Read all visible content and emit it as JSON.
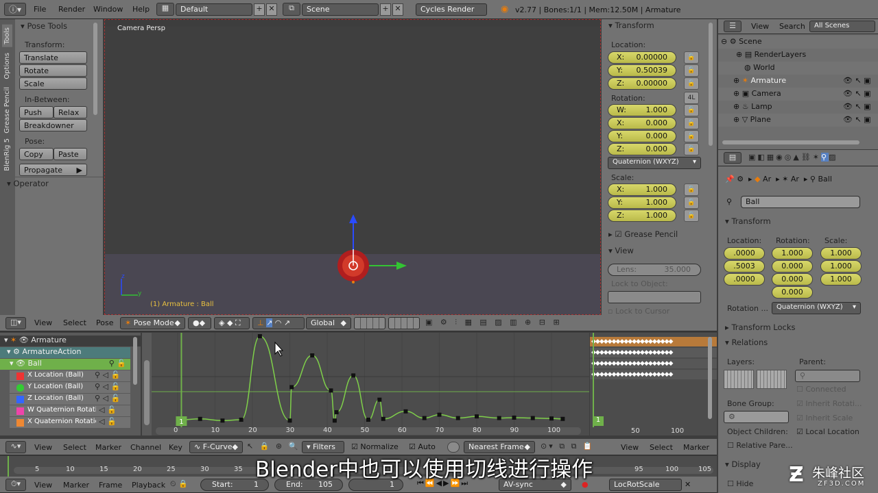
{
  "topbar": {
    "menus": [
      "File",
      "Render",
      "Window",
      "Help"
    ],
    "layout": "Default",
    "scene": "Scene",
    "engine": "Cycles Render",
    "stats": "v2.77 | Bones:1/1 | Mem:12.50M | Armature"
  },
  "tabs_left": [
    "Tools",
    "Options",
    "Grease Pencil",
    "BlenRig 5"
  ],
  "toolshelf": {
    "title": "Pose Tools",
    "transform_label": "Transform:",
    "translate": "Translate",
    "rotate": "Rotate",
    "scale": "Scale",
    "inbetween_label": "In-Between:",
    "push": "Push",
    "relax": "Relax",
    "breakdowner": "Breakdowner",
    "pose_label": "Pose:",
    "copy": "Copy",
    "paste": "Paste",
    "propagate": "Propagate",
    "operator": "Operator"
  },
  "viewport": {
    "title": "Camera Persp",
    "info": "(1) Armature : Ball",
    "axis_z": "z",
    "axis_y": "y"
  },
  "npanel": {
    "transform": "Transform",
    "location_label": "Location:",
    "loc": [
      {
        "k": "X:",
        "v": "0.00000"
      },
      {
        "k": "Y:",
        "v": "0.50039"
      },
      {
        "k": "Z:",
        "v": "0.00000"
      }
    ],
    "rotation_label": "Rotation:",
    "rot_badge": "4L",
    "rot": [
      {
        "k": "W:",
        "v": "1.000"
      },
      {
        "k": "X:",
        "v": "0.000"
      },
      {
        "k": "Y:",
        "v": "0.000"
      },
      {
        "k": "Z:",
        "v": "0.000"
      }
    ],
    "rot_mode": "Quaternion (WXYZ)",
    "scale_label": "Scale:",
    "scl": [
      {
        "k": "X:",
        "v": "1.000"
      },
      {
        "k": "Y:",
        "v": "1.000"
      },
      {
        "k": "Z:",
        "v": "1.000"
      }
    ],
    "grease_pencil": "Grease Pencil",
    "view": "View",
    "lens_label": "Lens:",
    "lens_value": "35.000",
    "lock_object": "Lock to Object:",
    "lock_cursor": "Lock to Cursor"
  },
  "view3d_header": {
    "view": "View",
    "select": "Select",
    "pose": "Pose",
    "mode": "Pose Mode",
    "orientation": "Global"
  },
  "outliner": {
    "view": "View",
    "search": "Search",
    "filter": "All Scenes",
    "items": [
      "Scene",
      "RenderLayers",
      "World",
      "Armature",
      "Camera",
      "Lamp",
      "Plane"
    ]
  },
  "props": {
    "crumb1": "Ar",
    "crumb2": "Ar",
    "crumb3": "Ball",
    "bone_name": "Ball",
    "transform": "Transform",
    "location_label": "Location:",
    "rotation_label": "Rotation:",
    "scale_label": "Scale:",
    "loc": [
      ".0000",
      ".5003",
      ".0000"
    ],
    "rot": [
      "1.000",
      "0.000",
      "0.000",
      "0.000"
    ],
    "scl": [
      "1.000",
      "1.000",
      "1.000"
    ],
    "rotation_mode_label": "Rotation ...",
    "rotation_mode": "Quaternion (WXYZ)",
    "transform_locks": "Transform Locks",
    "relations": "Relations",
    "layers_label": "Layers:",
    "parent_label": "Parent:",
    "connected": "Connected",
    "bone_group_label": "Bone Group:",
    "inherit_rotation": "Inherit Rotati...",
    "inherit_scale": "Inherit Scale",
    "object_children_label": "Object Children:",
    "local_location": "Local Location",
    "relative_parent": "Relative Pare...",
    "display": "Display",
    "hide": "Hide"
  },
  "channels": {
    "armature": "Armature",
    "action": "ArmatureAction",
    "group": "Ball",
    "curves": [
      {
        "name": "X Location (Ball)",
        "color": "#e33"
      },
      {
        "name": "Y Location (Ball)",
        "color": "#3c3"
      },
      {
        "name": "Z Location (Ball)",
        "color": "#36f"
      },
      {
        "name": "W Quaternion Rotation",
        "color": "#e4a"
      },
      {
        "name": "X Quaternion Rotation",
        "color": "#e83"
      }
    ]
  },
  "graph": {
    "ticks": [
      "0",
      "10",
      "20",
      "30",
      "40",
      "50",
      "60",
      "70",
      "80",
      "90",
      "100"
    ],
    "frame_badge": "1",
    "side_ticks": [
      "50",
      "100"
    ],
    "curve_keys": [
      [
        1,
        0
      ],
      [
        6,
        0.01
      ],
      [
        12,
        -0.01
      ],
      [
        17,
        0
      ],
      [
        22,
        1
      ],
      [
        30,
        -0.01
      ],
      [
        30.5,
        0.39
      ],
      [
        36,
        0.77
      ],
      [
        41,
        0.35
      ],
      [
        42,
        -0.01
      ],
      [
        42.5,
        0.09
      ],
      [
        47,
        0.53
      ],
      [
        51,
        0
      ],
      [
        54,
        0.24
      ],
      [
        55,
        0.01
      ],
      [
        61,
        0.1
      ],
      [
        66,
        0.02
      ],
      [
        70,
        0.06
      ],
      [
        75,
        0.02
      ],
      [
        80,
        0.04
      ],
      [
        86,
        0.02
      ],
      [
        90,
        0.025
      ],
      [
        95,
        0.02
      ],
      [
        100,
        0.015
      ],
      [
        103,
        0.01
      ]
    ]
  },
  "graph_header": {
    "view": "View",
    "select": "Select",
    "marker": "Marker",
    "channel": "Channel",
    "key": "Key",
    "mode": "F-Curve",
    "filters": "Filters",
    "normalize": "Normalize",
    "auto": "Auto",
    "snap": "Nearest Frame",
    "view2": "View",
    "select2": "Select",
    "marker2": "Marker"
  },
  "timeline": {
    "ticks": [
      "5",
      "10",
      "15",
      "20",
      "25",
      "30",
      "35",
      "95",
      "100",
      "105"
    ],
    "view": "View",
    "marker": "Marker",
    "frame": "Frame",
    "playback": "Playback",
    "start_label": "Start:",
    "start": "1",
    "end_label": "End:",
    "end": "105",
    "current": "1",
    "sync": "AV-sync",
    "keying": "LocRotScale"
  },
  "subtitle": "Blender中也可以使用切线进行操作",
  "watermark": {
    "name": "朱峰社区",
    "url": "ZF3D.COM"
  }
}
